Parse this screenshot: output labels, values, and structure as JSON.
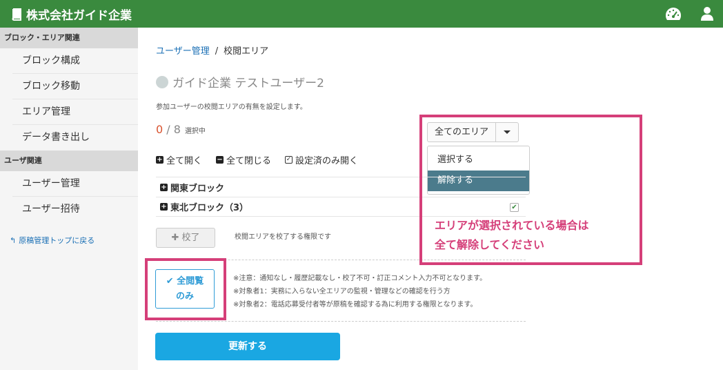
{
  "header": {
    "title": "株式会社ガイド企業"
  },
  "sidebar": {
    "sections": [
      {
        "heading": "ブロック・エリア関連",
        "items": [
          "ブロック構成",
          "ブロック移動",
          "エリア管理",
          "データ書き出し"
        ]
      },
      {
        "heading": "ユーザ関連",
        "items": [
          "ユーザー管理",
          "ユーザー招待"
        ]
      }
    ],
    "back_link": "原稿管理トップに戻る"
  },
  "breadcrumb": {
    "link": "ユーザー管理",
    "sep": "/",
    "current": "校閲エリア"
  },
  "page": {
    "title": "ガイド企業 テストユーザー2",
    "description": "参加ユーザーの校閲エリアの有無を設定します。",
    "selected": "0",
    "slash": " / ",
    "total": "8",
    "selected_label": "選択中"
  },
  "area_select": {
    "label": "全てのエリア",
    "options": [
      "選択する",
      "解除する"
    ]
  },
  "tools": {
    "expand_all": "全て開く",
    "collapse_all": "全て閉じる",
    "open_configured": "設定済のみ開く"
  },
  "tree": [
    {
      "label": "関東ブロック",
      "checked": false
    },
    {
      "label": "東北ブロック（3）",
      "checked": true
    }
  ],
  "kouryo": {
    "button": "校了",
    "note": "校閲エリアを校了する権限です"
  },
  "zen_button": {
    "line1": "全閲覧",
    "line2": "のみ"
  },
  "notes": [
    "※注意：通知なし・履歴記載なし・校了不可・訂正コメント入力不可となります。",
    "※対象者1：実務に入らない全エリアの監視・管理などの確認を行う方",
    "※対象者2：電話応募受付者等が原稿を確認する為に利用する権限となります。"
  ],
  "update_button": "更新する",
  "annotation": {
    "line1": "エリアが選択されている場合は",
    "line2": "全て解除してください",
    "color": "#d53f79"
  },
  "colors": {
    "header": "#3a8a3e",
    "accent": "#1aa7e2",
    "active_option": "#4b7b8c"
  }
}
